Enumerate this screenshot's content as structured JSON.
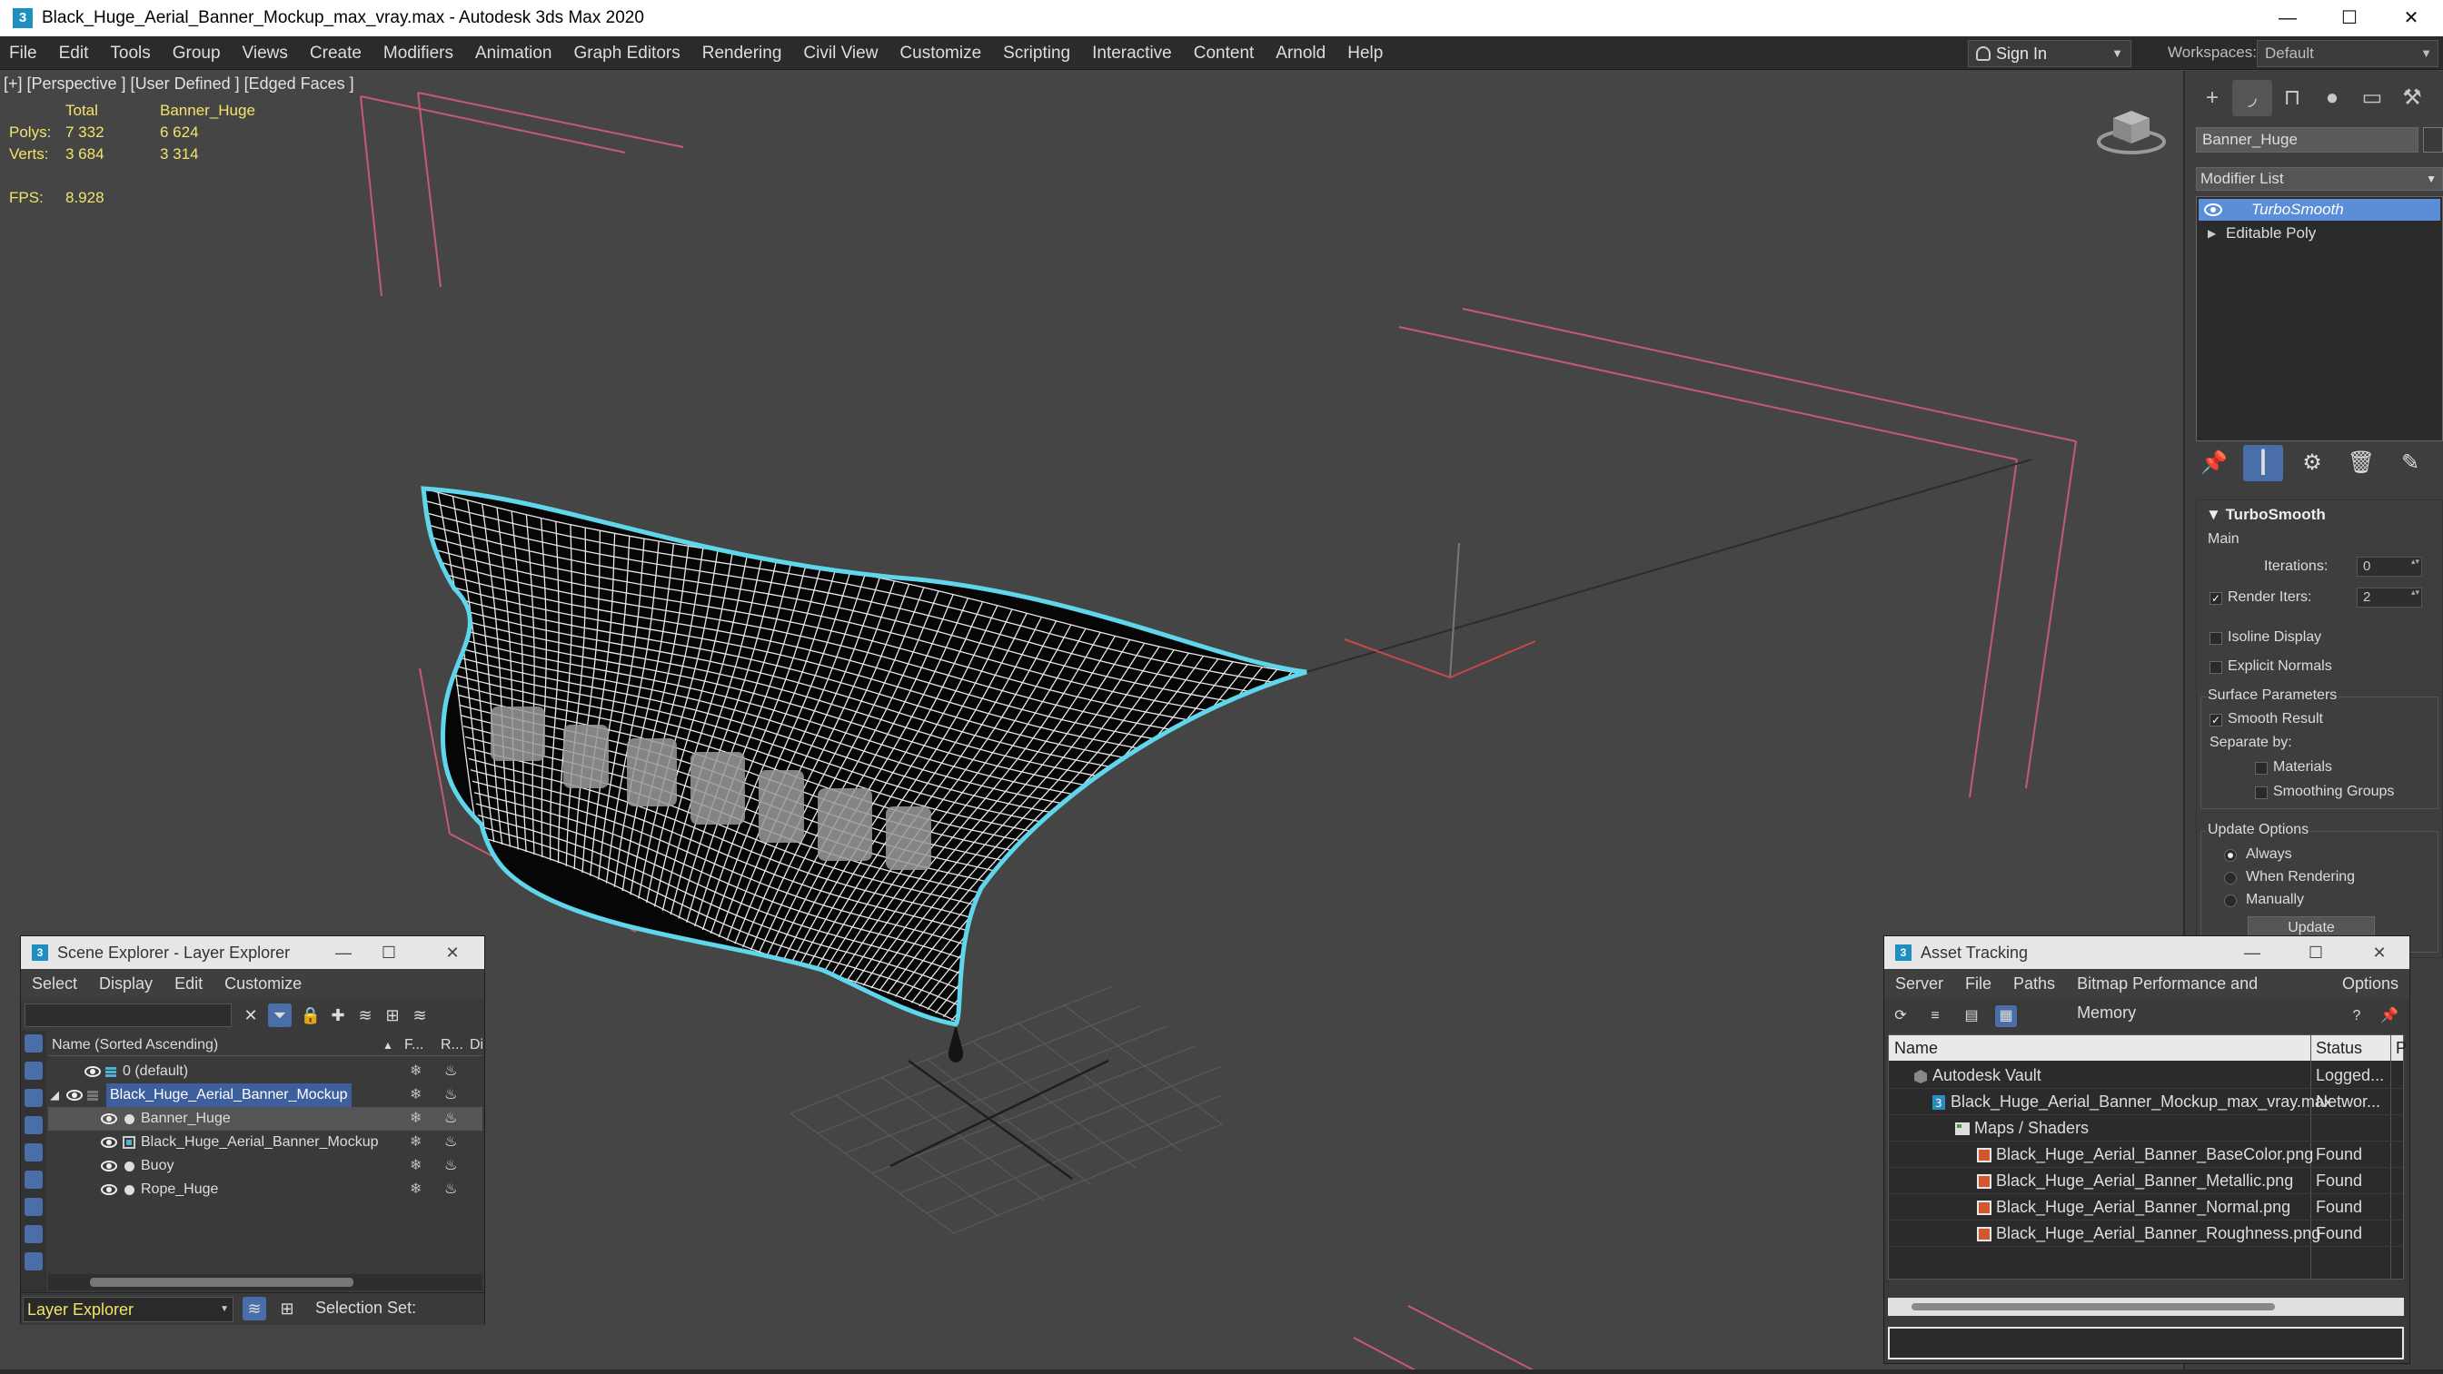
{
  "window": {
    "title": "Black_Huge_Aerial_Banner_Mockup_max_vray.max - Autodesk 3ds Max 2020",
    "app_icon": "3",
    "minimize": "—",
    "maximize": "☐",
    "close": "✕"
  },
  "menu": {
    "items": [
      "File",
      "Edit",
      "Tools",
      "Group",
      "Views",
      "Create",
      "Modifiers",
      "Animation",
      "Graph Editors",
      "Rendering",
      "Civil View",
      "Customize",
      "Scripting",
      "Interactive",
      "Content",
      "Arnold",
      "Help"
    ],
    "signin": "Sign In",
    "workspaces_label": "Workspaces:",
    "workspaces_value": "Default"
  },
  "viewport": {
    "label": "[+] [Perspective ] [User Defined ] [Edged Faces ]",
    "stats": {
      "col_total": "Total",
      "col_object": "Banner_Huge",
      "polys_label": "Polys:",
      "polys_total": "7 332",
      "polys_object": "6 624",
      "verts_label": "Verts:",
      "verts_total": "3 684",
      "verts_object": "3 314",
      "fps_label": "FPS:",
      "fps_value": "8.928"
    }
  },
  "command_panel": {
    "tabs": [
      "+",
      "◞",
      "⊓",
      "●",
      "▭",
      "⚒"
    ],
    "object_name": "Banner_Huge",
    "modifier_list": "Modifier List",
    "stack": [
      "TurboSmooth",
      "Editable Poly"
    ],
    "stack_tools": [
      "📌",
      "┃",
      "⚙",
      "🗑",
      "✎"
    ],
    "turbosmooth": {
      "header": "TurboSmooth",
      "main": "Main",
      "iterations_label": "Iterations:",
      "iterations_value": "0",
      "render_iters_label": "Render Iters:",
      "render_iters_value": "2",
      "render_iters_checked": true,
      "isoline": "Isoline Display",
      "explicit_normals": "Explicit Normals",
      "surface_params": "Surface Parameters",
      "smooth_result": "Smooth Result",
      "separate_by": "Separate by:",
      "materials": "Materials",
      "smoothing_groups": "Smoothing Groups",
      "update_options": "Update Options",
      "always": "Always",
      "when_rendering": "When Rendering",
      "manually": "Manually",
      "update_button": "Update"
    }
  },
  "scene_explorer": {
    "title": "Scene Explorer - Layer Explorer",
    "menu": [
      "Select",
      "Display",
      "Edit",
      "Customize"
    ],
    "columns": {
      "name": "Name (Sorted Ascending)",
      "f": "F...",
      "r": "R...",
      "display": "Displ"
    },
    "rows": [
      {
        "label": "0 (default)"
      },
      {
        "label": "Black_Huge_Aerial_Banner_Mockup"
      },
      {
        "label": "Banner_Huge"
      },
      {
        "label": "Black_Huge_Aerial_Banner_Mockup"
      },
      {
        "label": "Buoy"
      },
      {
        "label": "Rope_Huge"
      }
    ],
    "layer_dropdown": "Layer Explorer",
    "selection_set": "Selection Set:"
  },
  "asset_tracking": {
    "title": "Asset Tracking",
    "menu": [
      "Server",
      "File",
      "Paths",
      "Bitmap Performance and Memory",
      "Options"
    ],
    "columns": {
      "name": "Name",
      "status": "Status",
      "extra": "P"
    },
    "rows": [
      {
        "name": "Autodesk Vault",
        "status": "Logged..."
      },
      {
        "name": "Black_Huge_Aerial_Banner_Mockup_max_vray.max",
        "status": "Networ..."
      },
      {
        "name": "Maps / Shaders",
        "status": ""
      },
      {
        "name": "Black_Huge_Aerial_Banner_BaseColor.png",
        "status": "Found"
      },
      {
        "name": "Black_Huge_Aerial_Banner_Metallic.png",
        "status": "Found"
      },
      {
        "name": "Black_Huge_Aerial_Banner_Normal.png",
        "status": "Found"
      },
      {
        "name": "Black_Huge_Aerial_Banner_Roughness.png",
        "status": "Found"
      }
    ]
  },
  "colors": {
    "selection_cyan": "#5fd6ec",
    "stats_yellow": "#f2e46a",
    "highlight_blue": "#5a8ed8"
  }
}
